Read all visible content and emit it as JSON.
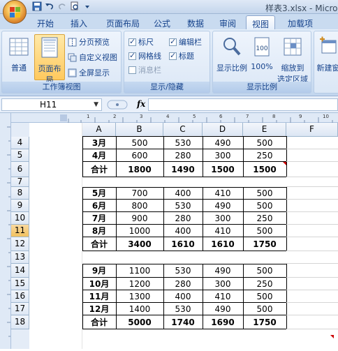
{
  "titlebar": {
    "title": "样表3.xlsx - Micro"
  },
  "tabs": [
    "开始",
    "插入",
    "页面布局",
    "公式",
    "数据",
    "审阅",
    "视图",
    "加载项"
  ],
  "active_tab": "视图",
  "ribbon": {
    "workbook_views": {
      "label": "工作簿视图",
      "normal": "普通",
      "page_layout": "页面布局",
      "page_break": "分页预览",
      "custom_views": "自定义视图",
      "full_screen": "全屏显示"
    },
    "show_hide": {
      "label": "显示/隐藏",
      "ruler": "标尺",
      "gridlines": "网格线",
      "message_bar": "消息栏",
      "formula_bar": "编辑栏",
      "headings": "标题"
    },
    "zoom": {
      "label": "显示比例",
      "zoom": "显示比例",
      "hundred": "100%",
      "zoom_selection": "缩放到选定区域",
      "zoom_selection_line1": "缩放到",
      "zoom_selection_line2": "选定区域"
    },
    "window": {
      "new_window": "新建窗"
    }
  },
  "formula_bar": {
    "name_box": "H11",
    "fx": "fx",
    "formula": ""
  },
  "columns": [
    "A",
    "B",
    "C",
    "D",
    "E",
    "F"
  ],
  "rows": [
    {
      "num": "4",
      "cells": [
        "3月",
        "500",
        "530",
        "490",
        "500"
      ]
    },
    {
      "num": "5",
      "cells": [
        "4月",
        "600",
        "280",
        "300",
        "250"
      ]
    },
    {
      "num": "6",
      "cells": [
        "合计",
        "1800",
        "1490",
        "1500",
        "1500"
      ]
    },
    {
      "num": "7",
      "cells": [
        "",
        "",
        "",
        "",
        ""
      ]
    },
    {
      "num": "8",
      "cells": [
        "5月",
        "700",
        "400",
        "410",
        "500"
      ]
    },
    {
      "num": "9",
      "cells": [
        "6月",
        "800",
        "530",
        "490",
        "500"
      ]
    },
    {
      "num": "10",
      "cells": [
        "7月",
        "900",
        "280",
        "300",
        "250"
      ]
    },
    {
      "num": "11",
      "cells": [
        "8月",
        "1000",
        "400",
        "410",
        "500"
      ]
    },
    {
      "num": "12",
      "cells": [
        "合计",
        "3400",
        "1610",
        "1610",
        "1750"
      ]
    },
    {
      "num": "13",
      "cells": [
        "",
        "",
        "",
        "",
        ""
      ]
    },
    {
      "num": "14",
      "cells": [
        "9月",
        "1100",
        "530",
        "490",
        "500"
      ]
    },
    {
      "num": "15",
      "cells": [
        "10月",
        "1200",
        "280",
        "300",
        "250"
      ]
    },
    {
      "num": "16",
      "cells": [
        "11月",
        "1300",
        "400",
        "410",
        "500"
      ]
    },
    {
      "num": "17",
      "cells": [
        "12月",
        "1400",
        "530",
        "490",
        "500"
      ]
    },
    {
      "num": "18",
      "cells": [
        "合计",
        "5000",
        "1740",
        "1690",
        "1750"
      ]
    }
  ],
  "selected_row": "11",
  "ruler_ticks": [
    "1",
    "2",
    "3",
    "4",
    "5",
    "6",
    "7",
    "8",
    "9",
    "10"
  ]
}
